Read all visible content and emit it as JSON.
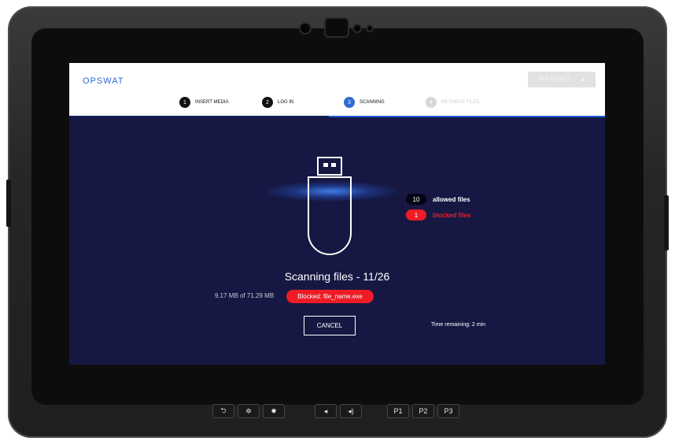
{
  "app": {
    "brand": "OPSWAT",
    "exit_label": "EXIT & EJECT",
    "exit_icon": "eject-icon"
  },
  "steps": [
    {
      "num": "1",
      "label": "INSERT MEDIA",
      "state": "done"
    },
    {
      "num": "2",
      "label": "LOG IN",
      "state": "done"
    },
    {
      "num": "3",
      "label": "SCANNING",
      "state": "active"
    },
    {
      "num": "4",
      "label": "RETRIEVE FILES",
      "state": "pending"
    }
  ],
  "results": {
    "allowed_count": "10",
    "allowed_label": "allowed files",
    "blocked_count": "1",
    "blocked_label": "blocked files"
  },
  "scan": {
    "title": "Scanning files - 11/26",
    "size_progress": "9.17 MB of 71.29 MB",
    "blocked_notice": "Blocked: file_name.exe",
    "cancel_label": "CANCEL",
    "time_remaining": "Time remaining: 2 min"
  },
  "hardware_buttons": [
    {
      "name": "back-icon",
      "glyph": "⮌"
    },
    {
      "name": "brightness-down-icon",
      "glyph": "✲"
    },
    {
      "name": "brightness-up-icon",
      "glyph": "✹"
    },
    {
      "name": "volume-down-icon",
      "glyph": "🔈"
    },
    {
      "name": "volume-up-icon",
      "glyph": "🔊"
    },
    {
      "label": "P1"
    },
    {
      "label": "P2"
    },
    {
      "label": "P3"
    }
  ],
  "colors": {
    "screen_bg": "#161843",
    "accent": "#2f6bd6",
    "blocked": "#ee1c25"
  }
}
